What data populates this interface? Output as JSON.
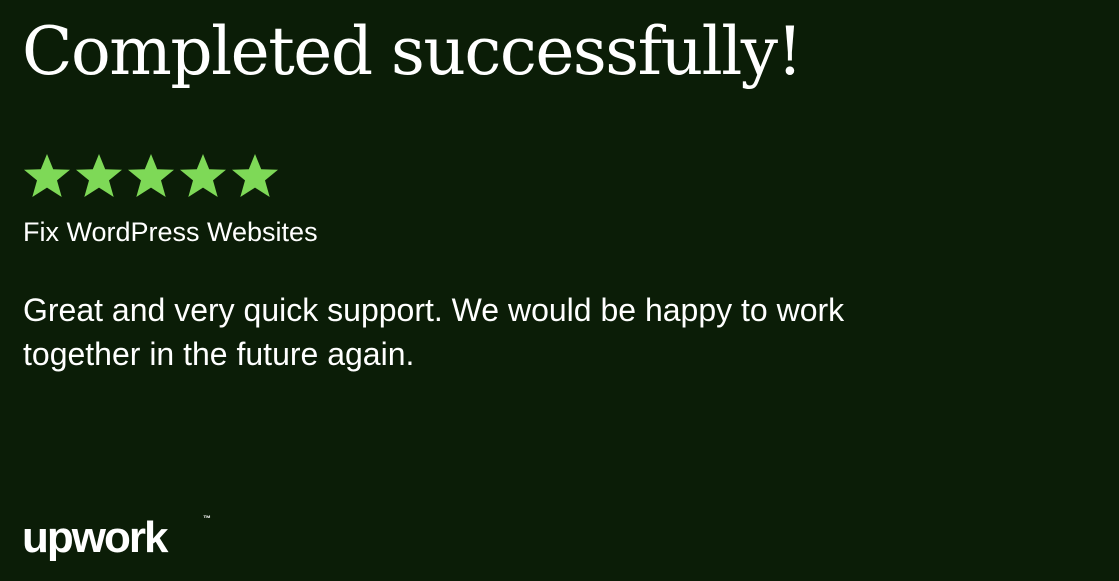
{
  "card": {
    "title": "Completed successfully!",
    "rating": {
      "value": 5,
      "max": 5,
      "star_color": "#7ed957"
    },
    "job_title": "Fix WordPress Websites",
    "review_text": "Great and very quick support. We would be happy to work together in the future again."
  },
  "brand": {
    "logo_text": "upwork",
    "trademark": "™"
  },
  "colors": {
    "background": "#0b1d07",
    "text": "#ffffff",
    "accent": "#7ed957"
  }
}
